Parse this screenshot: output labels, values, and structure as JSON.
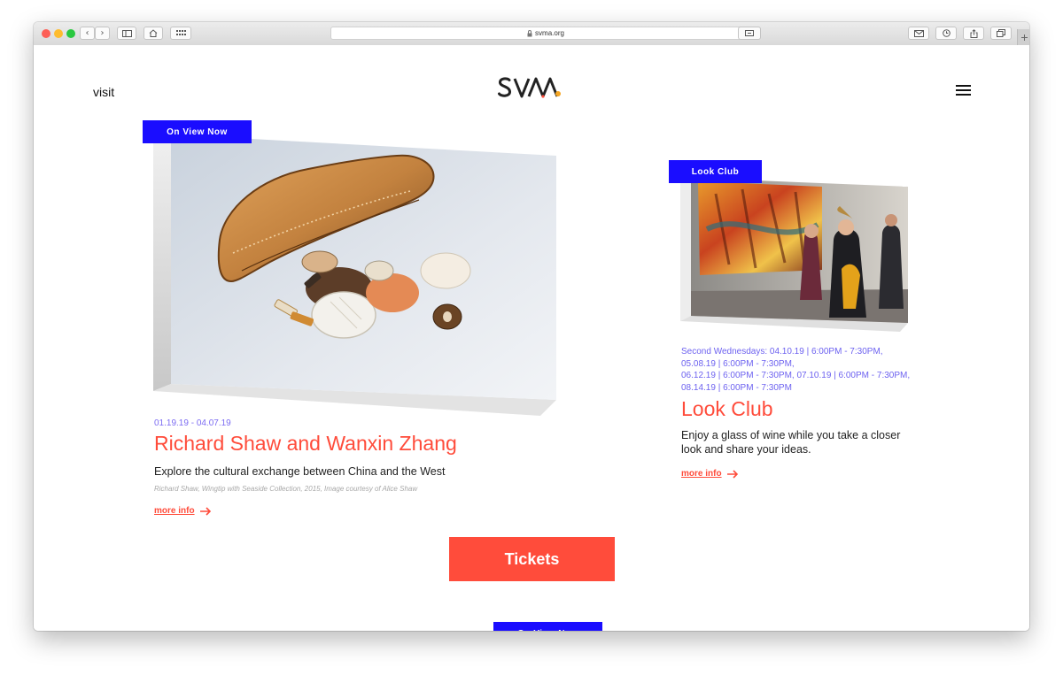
{
  "browser": {
    "url": "svma.org",
    "nav_back": "‹",
    "nav_forward": "›"
  },
  "header": {
    "visit_label": "visit",
    "logo_text": "SVMA"
  },
  "featured": {
    "badge": "On View Now",
    "dates": "01.19.19 - 04.07.19",
    "title": "Richard Shaw and Wanxin Zhang",
    "description": "Explore the cultural exchange between China and the West",
    "caption": "Richard Shaw, Wingtip with Seaside Collection, 2015, Image courtesy of Alice Shaw",
    "more_label": "more info"
  },
  "look_club": {
    "badge": "Look Club",
    "dates_lines": [
      "Second Wednesdays: 04.10.19 | 6:00PM - 7:30PM,",
      "05.08.19 | 6:00PM - 7:30PM,",
      "06.12.19 | 6:00PM - 7:30PM,  07.10.19 | 6:00PM - 7:30PM,",
      "08.14.19 | 6:00PM - 7:30PM"
    ],
    "title": "Look Club",
    "description": "Enjoy a glass of wine while you take a closer look and share your ideas.",
    "more_label": "more info"
  },
  "tickets_label": "Tickets",
  "bottom_badge": "On View Now",
  "colors": {
    "accent_blue": "#1a0dff",
    "accent_red": "#ff4c3b",
    "date_purple": "#7c6cf2"
  }
}
